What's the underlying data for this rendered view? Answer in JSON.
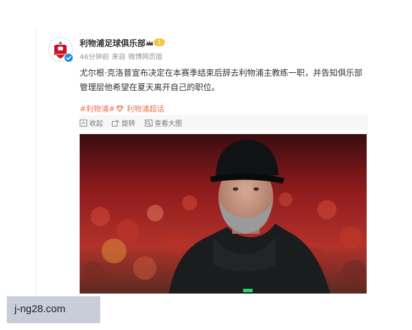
{
  "post": {
    "author_name": "利物浦足球俱乐部",
    "level": "1",
    "time": "46分钟前",
    "source_prefix": "来自",
    "source": "微博网页版",
    "text": "尤尔根·克洛普宣布决定在本赛季结束后辞去利物浦主教练一职，并告知俱乐部管理层他希望在夏天离开自己的职位。",
    "tags": {
      "first": "#利物浦#",
      "second": "利物浦超话"
    }
  },
  "media_actions": {
    "collapse": "收起",
    "rotate": "旋转",
    "view_full": "查看大图"
  },
  "watermark": "j-ng28.com",
  "colors": {
    "tag": "#eb7350",
    "liverpool_red": "#c8102e",
    "verified_blue": "#1e88e5",
    "badge_gold": "#f6c342"
  },
  "icons": [
    "liverpool-crest-icon",
    "verified-icon",
    "crown-icon",
    "super-topic-icon",
    "collapse-icon",
    "rotate-icon",
    "view-full-icon"
  ]
}
